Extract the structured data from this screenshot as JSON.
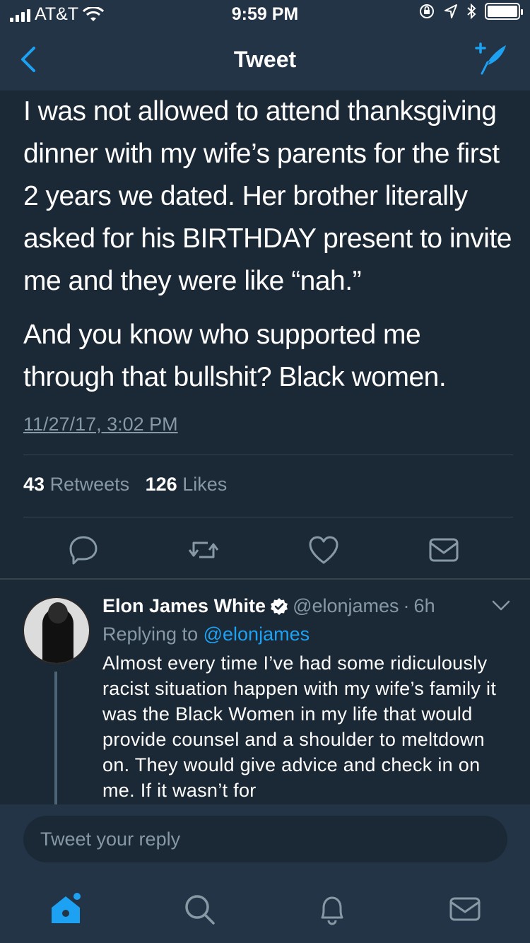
{
  "status_bar": {
    "carrier": "AT&T",
    "time": "9:59 PM"
  },
  "nav": {
    "title": "Tweet"
  },
  "tweet": {
    "paragraphs": [
      "I was not allowed to attend thanksgiving dinner with my wife’s parents for the first 2 years we dated. Her brother literally asked for his BIRTHDAY present to invite me and they were like “nah.”",
      "And you know who supported me through that bullshit? Black women."
    ],
    "timestamp": "11/27/17, 3:02 PM",
    "retweets_count": "43",
    "retweets_label": "Retweets",
    "likes_count": "126",
    "likes_label": "Likes"
  },
  "reply": {
    "author_name": "Elon James White",
    "author_handle": "@elonjames",
    "separator": "·",
    "time_ago": "6h",
    "replying_to_label": "Replying to",
    "replying_to_handle": "@elonjames",
    "text": "Almost every time I’ve had some ridiculously racist situation happen with my wife’s family it was the Black Women in my life that would provide counsel and a shoulder to meltdown on. They would give advice and check in on me. If it wasn’t for"
  },
  "composer": {
    "placeholder": "Tweet your reply"
  },
  "colors": {
    "background": "#1b2836",
    "bar": "#243447",
    "accent": "#1da1f2",
    "muted": "#8899a6",
    "divider": "#38444d"
  },
  "icons": {
    "back": "chevron-left-icon",
    "compose": "compose-tweet-icon",
    "reply": "reply-icon",
    "retweet": "retweet-icon",
    "like": "heart-icon",
    "dm": "message-icon",
    "verified": "verified-badge-icon",
    "caret": "chevron-down-icon",
    "home": "home-icon",
    "search": "search-icon",
    "notifications": "bell-icon",
    "messages": "envelope-icon"
  }
}
